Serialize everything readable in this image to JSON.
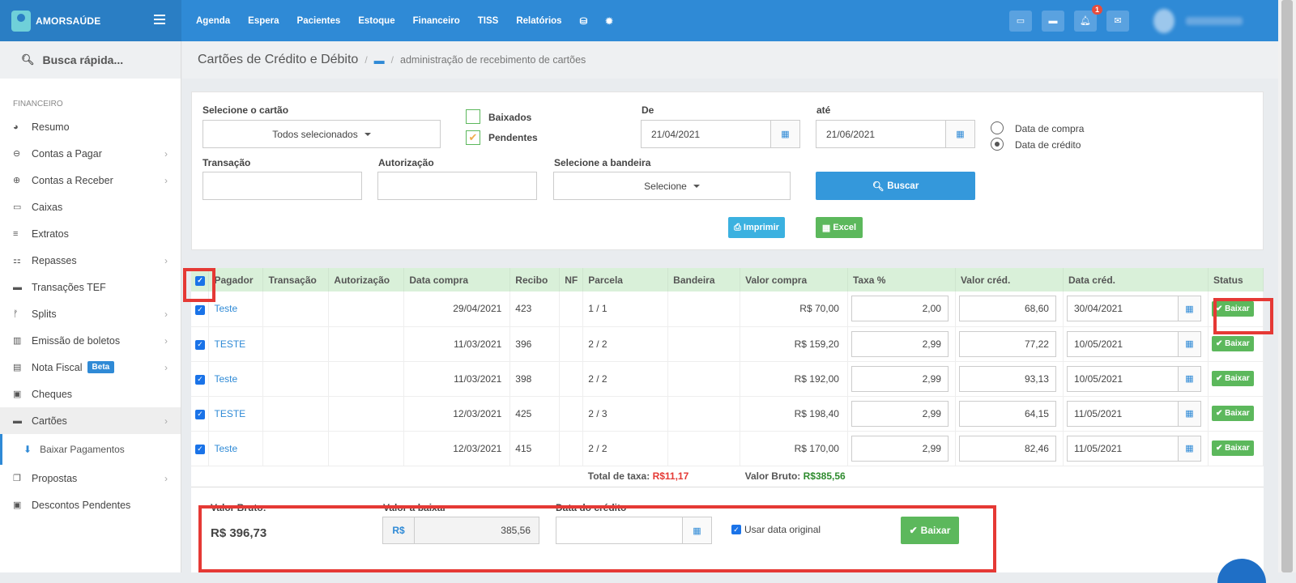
{
  "brand": {
    "name": "AMORSAÚDE"
  },
  "topnav": [
    "Agenda",
    "Espera",
    "Pacientes",
    "Estoque",
    "Financeiro",
    "TISS",
    "Relatórios"
  ],
  "notifications": {
    "count": "1"
  },
  "sidebar": {
    "search": "Busca rápida...",
    "section": "FINANCEIRO",
    "items": [
      {
        "label": "Resumo",
        "icon": "pie-chart-icon",
        "glyph": "◕"
      },
      {
        "label": "Contas a Pagar",
        "icon": "minus-circle-icon",
        "glyph": "⊖",
        "chev": true
      },
      {
        "label": "Contas a Receber",
        "icon": "plus-circle-icon",
        "glyph": "⊕",
        "chev": true
      },
      {
        "label": "Caixas",
        "icon": "inbox-icon",
        "glyph": "▭"
      },
      {
        "label": "Extratos",
        "icon": "list-icon",
        "glyph": "≡"
      },
      {
        "label": "Repasses",
        "icon": "sitemap-icon",
        "glyph": "⚏",
        "chev": true
      },
      {
        "label": "Transações TEF",
        "icon": "credit-card-icon",
        "glyph": "▬"
      },
      {
        "label": "Splits",
        "icon": "split-icon",
        "glyph": "ᚠ",
        "chev": true
      },
      {
        "label": "Emissão de boletos",
        "icon": "barcode-icon",
        "glyph": "▥",
        "chev": true
      },
      {
        "label": "Nota Fiscal",
        "icon": "file-icon",
        "glyph": "▤",
        "chev": true,
        "badge": "Beta"
      },
      {
        "label": "Cheques",
        "icon": "money-icon",
        "glyph": "▣"
      },
      {
        "label": "Cartões",
        "icon": "credit-card-icon",
        "glyph": "▬",
        "chev": true,
        "active": true
      }
    ],
    "sub_item": "Baixar Pagamentos",
    "items_after": [
      {
        "label": "Propostas",
        "icon": "copy-icon",
        "glyph": "❐",
        "chev": true
      },
      {
        "label": "Descontos Pendentes",
        "icon": "money-icon",
        "glyph": "▣"
      }
    ]
  },
  "page": {
    "title": "Cartões de Crédito e Débito",
    "crumb": "administração de recebimento de cartões"
  },
  "filters": {
    "card_label": "Selecione o cartão",
    "card_value": "Todos selecionados",
    "baixados": "Baixados",
    "pendentes": "Pendentes",
    "de_label": "De",
    "de_value": "21/04/2021",
    "ate_label": "até",
    "ate_value": "21/06/2021",
    "radio_compra": "Data de compra",
    "radio_credito": "Data de crédito",
    "transacao_label": "Transação",
    "autorizacao_label": "Autorização",
    "bandeira_label": "Selecione a bandeira",
    "bandeira_value": "Selecione",
    "buscar": "Buscar",
    "imprimir": "Imprimir",
    "excel": "Excel"
  },
  "table": {
    "headers": [
      "Pagador",
      "Transação",
      "Autorização",
      "Data compra",
      "Recibo",
      "NF",
      "Parcela",
      "Bandeira",
      "Valor compra",
      "Taxa %",
      "Valor créd.",
      "Data créd.",
      "Status"
    ],
    "rows": [
      {
        "pagador": "Teste",
        "data_compra": "29/04/2021",
        "recibo": "423",
        "parcela": "1 / 1",
        "valor_compra": "R$ 70,00",
        "taxa": "2,00",
        "valor_cred": "68,60",
        "data_cred": "30/04/2021"
      },
      {
        "pagador": "TESTE",
        "data_compra": "11/03/2021",
        "recibo": "396",
        "parcela": "2 / 2",
        "valor_compra": "R$ 159,20",
        "taxa": "2,99",
        "valor_cred": "77,22",
        "data_cred": "10/05/2021"
      },
      {
        "pagador": "Teste",
        "data_compra": "11/03/2021",
        "recibo": "398",
        "parcela": "2 / 2",
        "valor_compra": "R$ 192,00",
        "taxa": "2,99",
        "valor_cred": "93,13",
        "data_cred": "10/05/2021"
      },
      {
        "pagador": "TESTE",
        "data_compra": "12/03/2021",
        "recibo": "425",
        "parcela": "2 / 3",
        "valor_compra": "R$ 198,40",
        "taxa": "2,99",
        "valor_cred": "64,15",
        "data_cred": "11/05/2021"
      },
      {
        "pagador": "Teste",
        "data_compra": "12/03/2021",
        "recibo": "415",
        "parcela": "2 / 2",
        "valor_compra": "R$ 170,00",
        "taxa": "2,99",
        "valor_cred": "82,46",
        "data_cred": "11/05/2021"
      }
    ],
    "row_button": "Baixar",
    "total_taxa_label": "Total de taxa:",
    "total_taxa_value": "R$11,17",
    "valor_bruto_label": "Valor Bruto:",
    "valor_bruto_value": "R$385,56"
  },
  "bottom": {
    "valor_bruto_label": "Valor Bruto:",
    "valor_bruto_value": "R$ 396,73",
    "valor_baixar_label": "Valor a baixar",
    "currency": "R$",
    "valor_baixar_value": "385,56",
    "data_credito_label": "Data do crédito",
    "usar_data_original": "Usar data original",
    "baixar": "Baixar"
  },
  "colors": {
    "primary": "#2f8ad6",
    "success": "#5cb85c",
    "danger": "#e53935",
    "total_taxa": "#e53935",
    "valor_bruto": "#2e8b2e"
  }
}
